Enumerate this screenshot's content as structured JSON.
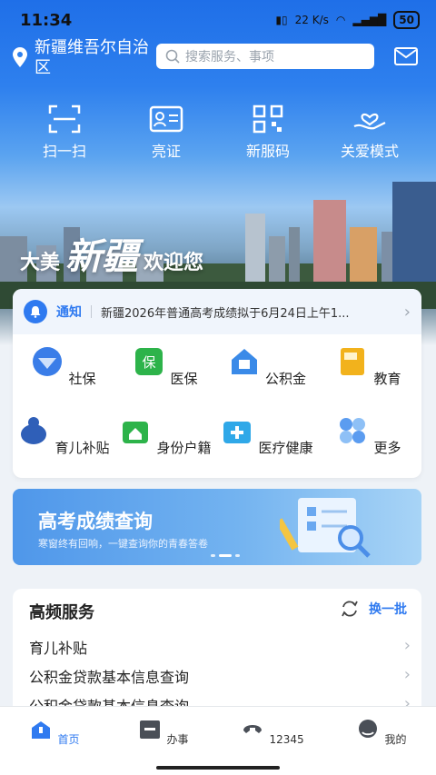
{
  "status": {
    "time": "11:34",
    "net_speed": "22 K/s",
    "battery": "50"
  },
  "header": {
    "location": "新疆维吾尔自治区",
    "search_placeholder": "搜索服务、事项"
  },
  "quick_actions": [
    {
      "label": "扫一扫",
      "icon": "scan-icon"
    },
    {
      "label": "亮证",
      "icon": "id-card-icon"
    },
    {
      "label": "新服码",
      "icon": "qr-code-icon"
    },
    {
      "label": "关爱模式",
      "icon": "care-mode-icon"
    }
  ],
  "hero": {
    "welcome_left": "大美",
    "welcome_big": "新疆",
    "welcome_right": "欢迎您"
  },
  "notice": {
    "tag": "通知",
    "text": "新疆2026年普通高考成绩拟于6月24日上午1..."
  },
  "services": [
    {
      "label": "社保",
      "icon": "social-security-icon",
      "color": "#3a7de8"
    },
    {
      "label": "医保",
      "icon": "medical-insurance-icon",
      "color": "#2db34a"
    },
    {
      "label": "公积金",
      "icon": "housing-fund-icon",
      "color": "#3a8ae8"
    },
    {
      "label": "教育",
      "icon": "education-icon",
      "color": "#f2b21c"
    },
    {
      "label": "育儿补贴",
      "icon": "childcare-subsidy-icon",
      "color": "#2f5fb8"
    },
    {
      "label": "身份户籍",
      "icon": "household-registration-icon",
      "color": "#2db34a"
    },
    {
      "label": "医疗健康",
      "icon": "medical-health-icon",
      "color": "#2fa8e8"
    },
    {
      "label": "更多",
      "icon": "more-icon",
      "color": "#5b9cf0"
    }
  ],
  "banner": {
    "title": "高考成绩查询",
    "subtitle": "寒窗终有回响，一键查询你的青春答卷"
  },
  "frequent": {
    "title": "高频服务",
    "refresh_label": "换一批",
    "items": [
      "育儿补贴",
      "公积金贷款基本信息查询",
      "公积金贷款基本信息查询"
    ]
  },
  "tabs": [
    {
      "label": "首页",
      "icon": "home-icon",
      "active": true
    },
    {
      "label": "办事",
      "icon": "tasks-icon",
      "active": false
    },
    {
      "label": "12345",
      "icon": "hotline-icon",
      "active": false
    },
    {
      "label": "我的",
      "icon": "profile-icon",
      "active": false
    }
  ],
  "colors": {
    "accent": "#2f7af0",
    "hero_top": "#1f6fe8"
  }
}
